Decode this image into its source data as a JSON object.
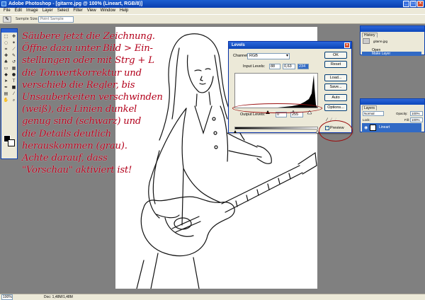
{
  "window": {
    "title": "Adobe Photoshop - [gitarre.jpg @ 100% (Lineart, RGB/8)]"
  },
  "menu": [
    "File",
    "Edit",
    "Image",
    "Layer",
    "Select",
    "Filter",
    "View",
    "Window",
    "Help"
  ],
  "options": {
    "sample_size_label": "Sample Size:",
    "sample_size_value": "Point Sample"
  },
  "tutorial_lines": [
    "Säubere jetzt die Zeichnung.",
    "Öffne dazu unter Bild > Ein-",
    "stellungen oder mit Strg + L",
    "die Tonwertkorrektur und",
    "verschieb die Regler, bis",
    "Unsauberkeiten verschwinden",
    "(weiß), die Linien dunkel",
    "genug sind (schwarz) und",
    "die Details deutlich",
    "herauskommen (grau).",
    "Achte darauf, dass",
    "\"Vorschau\" aktiviert ist!"
  ],
  "levels": {
    "title": "Levels",
    "channel_label": "Channel:",
    "channel_value": "RGB",
    "input_label": "Input Levels:",
    "input_black": "88",
    "input_gamma": "0,63",
    "input_white": "234",
    "output_label": "Output Levels:",
    "output_black": "0",
    "output_white": "255",
    "buttons": {
      "ok": "OK",
      "reset": "Reset",
      "load": "Load...",
      "save": "Save...",
      "auto": "Auto",
      "options": "Options..."
    },
    "preview_label": "Preview",
    "preview_checked": true
  },
  "history": {
    "tab": "History",
    "snapshot": "gitarre.jpg",
    "items": [
      "Open",
      "Make Layer"
    ]
  },
  "layers": {
    "tab": "Layers",
    "blend_mode": "Normal",
    "opacity_label": "Opacity:",
    "opacity_value": "100%",
    "lock_label": "Lock:",
    "fill_label": "Fill:",
    "fill_value": "100%",
    "layer_name": "Lineart"
  },
  "status": {
    "zoom": "100%",
    "doc": "Doc: 1,48M/1,48M"
  },
  "colors": {
    "accent": "#0a3fb0",
    "tutorial_text": "#b3001b",
    "highlight": "#316ac5"
  }
}
